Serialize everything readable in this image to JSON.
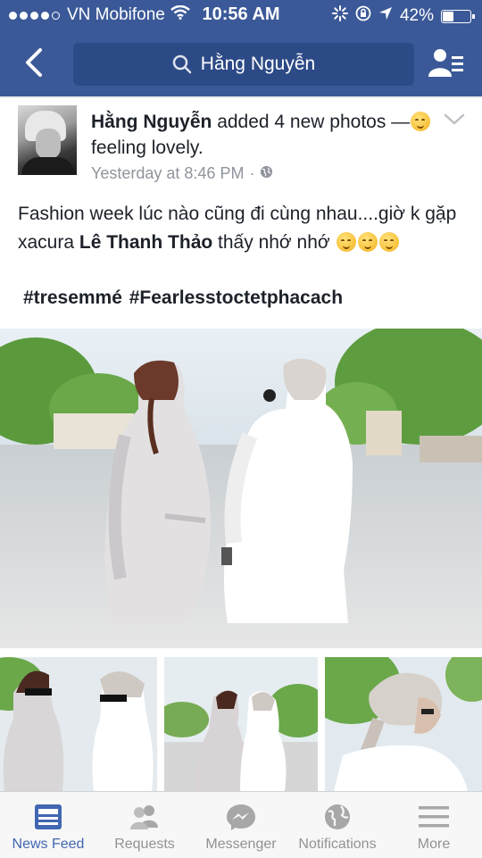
{
  "status_bar": {
    "carrier": "VN Mobifone",
    "time": "10:56 AM",
    "battery": "42%",
    "battery_level": 0.42
  },
  "header": {
    "search_text": "Hằng Nguyễn"
  },
  "post": {
    "author": "Hằng Nguyễn",
    "action_text": "added 4 new photos —",
    "feeling_text": "feeling lovely.",
    "timestamp": "Yesterday at 8:46 PM",
    "privacy_icon": "globe-icon",
    "body_text_part1": "Fashion week lúc nào cũng đi cùng nhau....giờ k gặp xacura",
    "body_tag": "Lê Thanh Thảo",
    "body_text_part2": "thấy nhớ nhớ",
    "hashtags": "#tresemmé #Fearlesstoctetphacach"
  },
  "tabbar": {
    "tabs": [
      {
        "label": "News Feed",
        "icon": "news-feed-icon",
        "active": true
      },
      {
        "label": "Requests",
        "icon": "requests-icon",
        "active": false
      },
      {
        "label": "Messenger",
        "icon": "messenger-icon",
        "active": false
      },
      {
        "label": "Notifications",
        "icon": "globe-icon",
        "active": false
      },
      {
        "label": "More",
        "icon": "menu-icon",
        "active": false
      }
    ]
  },
  "colors": {
    "header_blue": "#3b5998",
    "active_tab": "#4267b2",
    "inactive_tab": "#929292"
  }
}
